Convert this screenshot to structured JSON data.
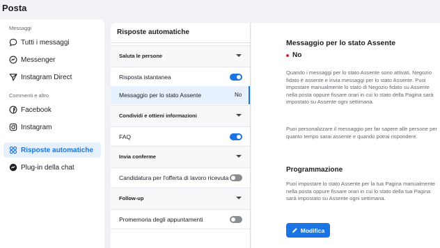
{
  "page": {
    "title": "Posta"
  },
  "sidebar": {
    "section_messages": "Messaggi",
    "items_messages": [
      {
        "label": "Tutti i messaggi",
        "icon": "chat-bubble-icon"
      },
      {
        "label": "Messenger",
        "icon": "messenger-icon"
      },
      {
        "label": "Instagram Direct",
        "icon": "paper-plane-icon"
      }
    ],
    "section_comments": "Commenti e altro",
    "items_comments": [
      {
        "label": "Facebook",
        "icon": "facebook-icon"
      },
      {
        "label": "Instagram",
        "icon": "instagram-icon"
      }
    ],
    "items_tools": [
      {
        "label": "Risposte automatiche",
        "icon": "gear-cluster-icon",
        "active": true
      },
      {
        "label": "Plug-in della chat",
        "icon": "messenger-icon"
      }
    ]
  },
  "middle": {
    "title": "Risposte automatiche",
    "sections": [
      {
        "title": "Saluta le persone"
      },
      {
        "title": "Condividi e ottieni informazioni"
      },
      {
        "title": "Invia conferme"
      },
      {
        "title": "Follow-up"
      }
    ],
    "rows": [
      {
        "label": "Risposta istantanea",
        "toggle": "on"
      },
      {
        "label": "Messaggio per lo stato Assente",
        "value": "No"
      },
      {
        "label": "FAQ",
        "toggle": "on"
      },
      {
        "label": "Candidatura per l'offerta di lavoro ricevuta",
        "toggle": "off"
      },
      {
        "label": "Promemoria degli appuntamenti",
        "toggle": "off"
      }
    ]
  },
  "detail": {
    "title": "Messaggio per lo stato Assente",
    "status": "No",
    "status_color": "#e41e3f",
    "paragraph1": "Quando i messaggi per lo stato Assente sono attivati, Negozio fidato è assente e invia messaggi per lo stato Assente. Puoi impostare manualmente lo stato di Negozio fidato su Assente nella posta oppure fissare orari in cui lo stato della Pagina sarà impostato su Assente ogni settimana.",
    "paragraph2": "Puoi personalizzare il messaggio per far sapere alle persone per quanto tempo sarai assente e quando potrai rispondere.",
    "schedule_title": "Programmazione",
    "schedule_text": "Puoi impostare lo stato Assente per la tua Pagina manualmente nella posta oppure fissare orari in cui lo stato della tua Pagina sarà impostato su Assente ogni settimana.",
    "edit_button": "Modifica"
  },
  "colors": {
    "accent": "#1b74e4",
    "background": "#f0f2f5"
  }
}
